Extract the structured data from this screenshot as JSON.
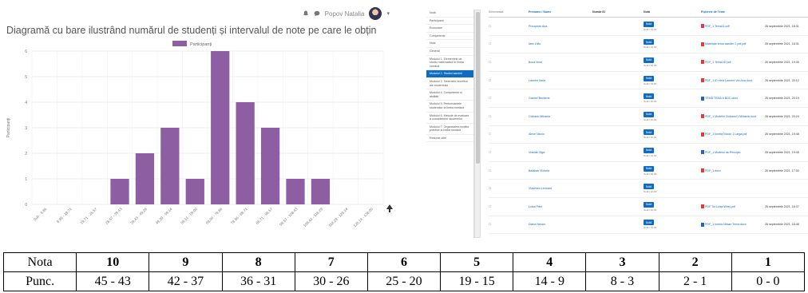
{
  "chart_panel": {
    "user_name": "Popov Natalia",
    "chart_title": "Diagramă cu bare ilustrând numărul de studenți și intervalul de note pe care le obțin"
  },
  "chart_data": {
    "type": "bar",
    "title": "Diagramă cu bare ilustrând numărul de studenți și intervalul de note pe care le obțin",
    "xlabel": "",
    "ylabel": "Participanți",
    "ylim": [
      0,
      6
    ],
    "yticks": [
      0,
      1,
      2,
      3,
      4,
      5,
      6
    ],
    "categories": [
      "Sub - 8,86",
      "8,86 - 19,71",
      "19,71 - 28,57",
      "28,57 - 39,43",
      "39,43 - 49,29",
      "49,29 - 59,14",
      "59,14 - 69,00",
      "69,00 - 78,86",
      "78,86 - 88,71",
      "88,71 - 98,57",
      "98,57 - 108,43",
      "108,43 - 118,29",
      "118,29 - 128,14",
      "128,14 - 138,00"
    ],
    "series": [
      {
        "name": "Participanți",
        "color": "#8e5ea2",
        "values": [
          0,
          0,
          0,
          1,
          2,
          3,
          1,
          6,
          4,
          3,
          1,
          1,
          0,
          0
        ]
      }
    ],
    "grid": true,
    "legend": "top-center"
  },
  "grader": {
    "nav_items": [
      "Notă",
      "Participanți",
      "Ecusoane",
      "Competențe",
      "Note",
      "General",
      "Modulul 1. Elementele de studiu matematică în limba română",
      "Modulul 2. Studiul sarcinii",
      "Modulul 3. Sistemele teoretice ale studentului",
      "Modulul 4. Competențe și abilități",
      "Modulul 5. Performanțele studenților la limba română",
      "Modulul 6. Metode de evaluare a cunoștințelor studenților",
      "Modulul 7. Organizarea lecțiilor practice la limba română",
      "Resurse utile"
    ],
    "active_nav_index": 7,
    "columns": [
      "Selectează",
      "Prenume / Nume",
      "Număr ID",
      "",
      "Notă",
      "",
      "Fișierele de Teme",
      ""
    ],
    "rows": [
      {
        "name": "Pricopean Ana",
        "file": "PDF_1 Tema11.pdf",
        "date": "26 septembrie 2021, 18:31"
      },
      {
        "name": "Ianc Liviu",
        "file": "Materiale tema asedim 2 pdf.pdf",
        "date": "26 septembrie 2021, 18:31"
      },
      {
        "name": "Boca Ionut",
        "file": "PDF_1 Tema1ID.pdf",
        "date": "26 septembrie 2021, 19:35"
      },
      {
        "name": "Laurent Ilaria",
        "file": "PDF_1 ID elevi Laurent Vin.Ana.docx",
        "date": "26 septembrie 2021, 20:12"
      },
      {
        "name": "Gabriel Beckens",
        "file": "TEMĂ TEMA 6 BOC.docx",
        "date": "26 septembrie 2021, 20:19"
      },
      {
        "name": "Ciobanu Mihaela",
        "file": "PDF_1 Modelul Ciobanu/1 Mihaela.docx",
        "date": "26 septembrie 2021, 20:24"
      },
      {
        "name": "Alexe Nicolo",
        "file": "PDF_1 Ioneta Nicolo 1 Larga.pdf",
        "date": "26 septembrie 2021, 19:48"
      },
      {
        "name": "Vlasiak Olga",
        "file": "PDF_1 Modelul de Principiu",
        "date": "26 septembrie 2021, 19:45"
      },
      {
        "name": "Balaban Victoria",
        "file": "PDF_1 docx",
        "date": "26 septembrie 2021, 17:00"
      },
      {
        "name": "Vlasenko Leonard",
        "file": "",
        "date": ""
      },
      {
        "name": "Luisa Piter",
        "file": "PDF Tot Luisa Wrist.pdf",
        "date": "26 septembrie 2021, 18:37"
      },
      {
        "name": "Diana Nesan",
        "file": "PDF_1 Ionela Nesan Tema.docx",
        "date": "26 septembrie 2021, 18:46"
      }
    ],
    "grade_button_label": "Notă",
    "grade_sub": "Notă / 10,00",
    "file_colors": [
      "red",
      "red",
      "red",
      "red",
      "blue",
      "red",
      "red",
      "blue",
      "red",
      "",
      "red",
      "blue"
    ]
  },
  "grades_table": {
    "row_headers": [
      "Nota",
      "Punc."
    ],
    "notes": [
      "10",
      "9",
      "8",
      "7",
      "6",
      "5",
      "4",
      "3",
      "2",
      "1"
    ],
    "points": [
      "45 - 43",
      "42 - 37",
      "36 - 31",
      "30 - 26",
      "25 - 20",
      "19 - 15",
      "14 - 9",
      "8 - 3",
      "2 - 1",
      "0 - 0"
    ]
  }
}
